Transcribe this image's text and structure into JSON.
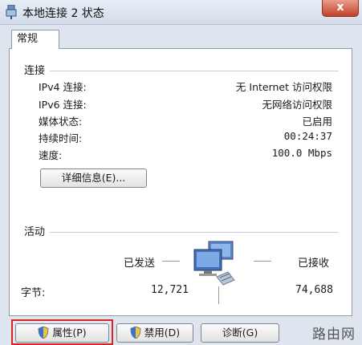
{
  "window": {
    "title": "本地连接 2 状态",
    "close_label": "x"
  },
  "tabs": [
    {
      "label": "常规"
    }
  ],
  "connection": {
    "heading": "连接",
    "rows": [
      {
        "label": "IPv4 连接:",
        "value": "无 Internet 访问权限"
      },
      {
        "label": "IPv6 连接:",
        "value": "无网络访问权限"
      },
      {
        "label": "媒体状态:",
        "value": "已启用"
      },
      {
        "label": "持续时间:",
        "value": "00:24:37"
      },
      {
        "label": "速度:",
        "value": "100.0 Mbps"
      }
    ],
    "details_button": "详细信息(E)..."
  },
  "activity": {
    "heading": "活动",
    "sent_label": "已发送",
    "received_label": "已接收",
    "bytes_label": "字节:",
    "bytes_sent": "12,721",
    "bytes_received": "74,688",
    "network_icon": "network-computers-icon"
  },
  "buttons": {
    "properties": "属性(P)",
    "disable": "禁用(D)",
    "diagnose": "诊断(G)"
  },
  "watermark": "路由网",
  "colors": {
    "highlight": "#d42525",
    "window_bg": "#dfe5ee"
  }
}
